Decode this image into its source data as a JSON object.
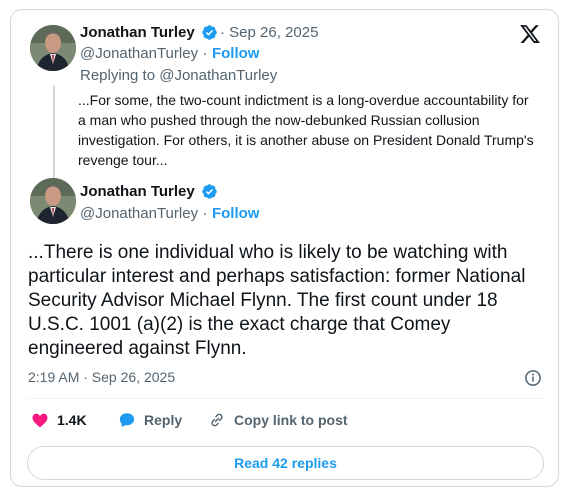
{
  "quoted_tweet": {
    "author_name": "Jonathan Turley",
    "date": "Sep 26, 2025",
    "handle": "@JonathanTurley",
    "follow_label": "Follow",
    "replying_to": "Replying to @JonathanTurley",
    "text": "...For some, the two-count indictment is a long-overdue accountability for a man who pushed through the now-debunked Russian collusion investigation. For others, it is another abuse on President Donald Trump's revenge tour..."
  },
  "tweet": {
    "author_name": "Jonathan Turley",
    "handle": "@JonathanTurley",
    "follow_label": "Follow",
    "text": "...There is one individual who is likely to be watching with particular interest and perhaps satisfaction: former National Security Advisor Michael Flynn. The first count under 18 U.S.C. 1001 (a)(2) is the exact charge that Comey engineered against Flynn.",
    "timestamp": "2:19 AM · Sep 26, 2025"
  },
  "actions": {
    "like_count": "1.4K",
    "reply_label": "Reply",
    "copy_link_label": "Copy link to post"
  },
  "read_replies_label": "Read 42 replies",
  "separator": "·",
  "colors": {
    "accent": "#1d9bf0",
    "like": "#f91880",
    "muted": "#536471"
  }
}
